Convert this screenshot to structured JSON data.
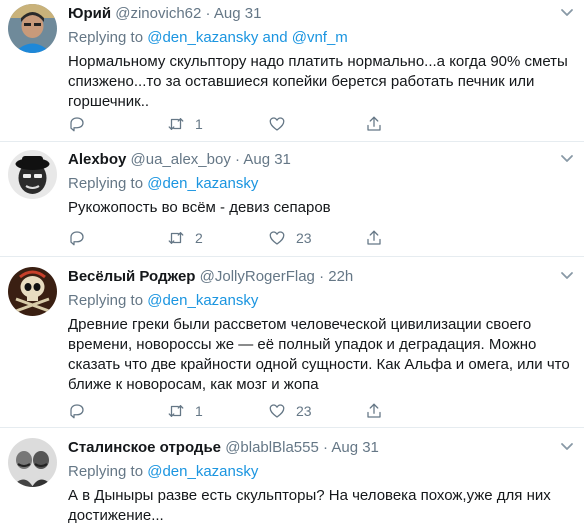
{
  "tweets": [
    {
      "name": "Юрий",
      "handle": "@zinovich62",
      "separator": "·",
      "time": "Aug 31",
      "replying_prefix": "Replying to ",
      "mention1": "@den_kazansky",
      "mention_joiner": " and ",
      "mention2": "@vnf_m",
      "text": "Нормальному скульптору надо платить нормально...а когда 90% сметы спизжено...то за оставшиеся копейки берется работать печник или горшечник..",
      "replies": "",
      "retweets": "1",
      "likes": ""
    },
    {
      "name": "Alexboy",
      "handle": "@ua_alex_boy",
      "separator": "·",
      "time": "Aug 31",
      "replying_prefix": "Replying to ",
      "mention1": "@den_kazansky",
      "text": "Рукожопость во всём - девиз сепаров",
      "replies": "",
      "retweets": "2",
      "likes": "23"
    },
    {
      "name": "Весёлый Роджер",
      "handle": "@JollyRogerFlag",
      "separator": "·",
      "time": "22h",
      "replying_prefix": "Replying to ",
      "mention1": "@den_kazansky",
      "text": "Древние греки были рассветом человеческой цивилизации своего времени, новороссы же — её полный упадок и деградация. Можно сказать что две крайности одной сущности. Как Альфа и омега, или что ближе к новоросам, как мозг и жопа",
      "replies": "",
      "retweets": "1",
      "likes": "23"
    },
    {
      "name": "Сталинское отродье",
      "handle": "@blablBla555",
      "separator": "·",
      "time": "Aug 31",
      "replying_prefix": "Replying to ",
      "mention1": "@den_kazansky",
      "text": "А в Дыныры разве есть скульпторы? На человека похож,уже для них достижение..."
    }
  ],
  "icons": {
    "reply": "reply-icon",
    "retweet": "retweet-icon",
    "like": "heart-icon",
    "share": "share-icon",
    "more": "chevron-down-icon"
  },
  "colors": {
    "link": "#1b95e0",
    "secondary_text": "#657786",
    "divider": "#e6ecf0"
  }
}
